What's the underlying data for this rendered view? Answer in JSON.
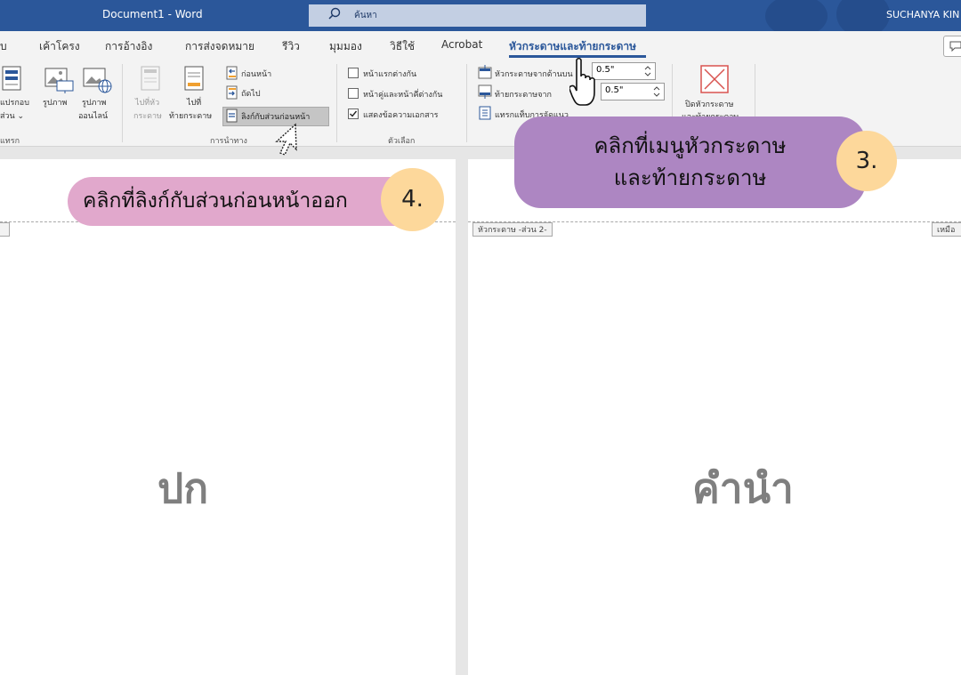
{
  "window": {
    "title": "Document1  -  Word",
    "search_placeholder": "ค้นหา",
    "user": "SUCHANYA KIN"
  },
  "tabs": [
    "บ",
    "เค้าโครง",
    "การอ้างอิง",
    "การส่งจดหมาย",
    "รีวิว",
    "มุมมอง",
    "วิธีใช้",
    "Acrobat",
    "หัวกระดาษและท้ายกระดาษ"
  ],
  "ribbon": {
    "insert": {
      "quick_parts_1": "แปรกอบ",
      "quick_parts_2": "ส่วน ⌄",
      "pictures": "รูปภาพ",
      "online_pictures_1": "รูปภาพ",
      "online_pictures_2": "ออนไลน์",
      "group": "แทรก"
    },
    "navigation": {
      "goto_header_1": "ไปที่หัว",
      "goto_header_2": "กระดาษ",
      "goto_footer_1": "ไปที่",
      "goto_footer_2": "ท้ายกระดาษ",
      "previous": "ก่อนหน้า",
      "next": "ถัดไป",
      "link_to_previous": "ลิงก์กับส่วนก่อนหน้า",
      "group": "การนำทาง"
    },
    "options": {
      "different_first_page": "หน้าแรกต่างกัน",
      "different_odd_even": "หน้าคู่และหน้าคี่ต่างกัน",
      "show_document_text": "แสดงข้อความเอกสาร",
      "show_document_text_checked": true,
      "group": "ตัวเลือก"
    },
    "position": {
      "header_from_top": "หัวกระดาษจากด้านบน",
      "footer_from_bottom": "ท้ายกระดาษจาก",
      "insert_alignment_tab": "แทรกแท็บการจัดแนว",
      "header_value": "0.5\"",
      "footer_value": "0.5\""
    },
    "close": {
      "label_1": "ปิดหัวกระดาษ",
      "label_2": "และท้ายกระดาษ"
    }
  },
  "pages": {
    "left_text": "ปก",
    "right_text": "คำนำ",
    "header_tag_right": "หัวกระดาษ -ส่วน 2-",
    "header_tag_far_right": "เหมือ"
  },
  "callouts": {
    "step3_line1": "คลิกที่เมนูหัวกระดาษ",
    "step3_line2": "และท้ายกระดาษ",
    "step3_num": "3.",
    "step4_text": "คลิกที่ลิงก์กับส่วนก่อนหน้าออก",
    "step4_num": "4."
  },
  "colors": {
    "title_bar": "#2b579a",
    "callout_purple": "#ad86c2",
    "callout_pink": "#e1a8cc",
    "number_badge": "#fdd89b"
  }
}
